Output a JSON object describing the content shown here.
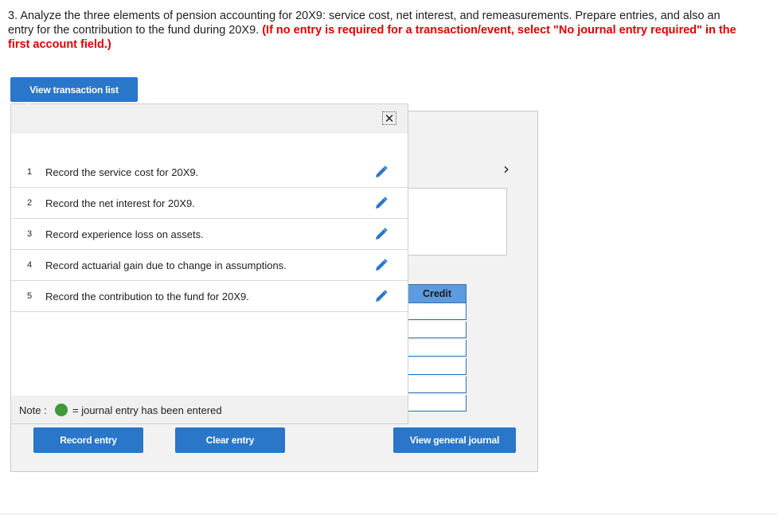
{
  "instructions": {
    "text": "3. Analyze the three elements of pension accounting for 20X9: service cost, net interest, and remeasurements. Prepare entries, and also an entry for the contribution to the fund during 20X9. ",
    "emphasis": "(If no entry is required for a transaction/event, select \"No journal entry required\" in the first account field.)"
  },
  "buttons": {
    "view_transactions": "View transaction list",
    "record_entry": "Record entry",
    "clear_entry": "Clear entry",
    "view_general_journal": "View general journal"
  },
  "popup": {
    "close_icon": "close-icon",
    "transactions": [
      {
        "num": "1",
        "label": "Record the service cost for 20X9."
      },
      {
        "num": "2",
        "label": "Record the net interest for 20X9."
      },
      {
        "num": "3",
        "label": "Record experience loss on assets."
      },
      {
        "num": "4",
        "label": "Record actuarial gain due to change in assumptions."
      },
      {
        "num": "5",
        "label": "Record the contribution to the fund for 20X9."
      }
    ],
    "note_label": "Note :",
    "note_text": "= journal entry has been entered"
  },
  "journal": {
    "credit_header": "Credit",
    "next_icon": "chevron-right-icon"
  },
  "colors": {
    "button_blue": "#2a76c9",
    "instruction_red": "#e00000",
    "entered_green": "#3f9a3a",
    "credit_header": "#5b9be0"
  }
}
